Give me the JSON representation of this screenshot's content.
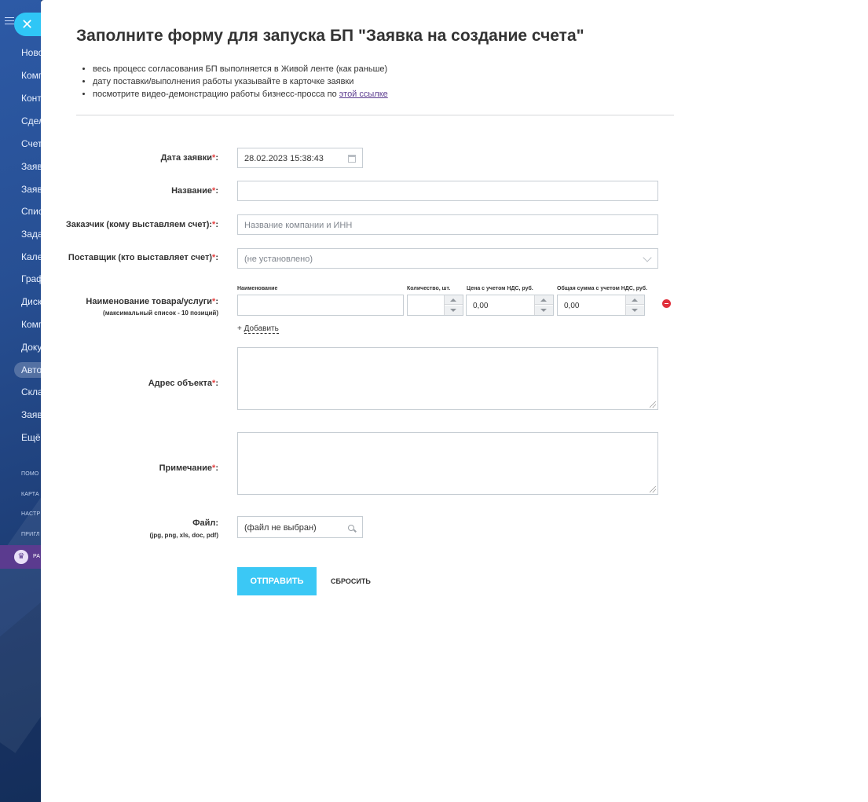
{
  "sidebar": {
    "items": [
      "Ново",
      "Комп",
      "Конт",
      "Сдел",
      "Счет",
      "Заяв",
      "Заяв",
      "Спис",
      "Зада",
      "Кале",
      "Граф",
      "Диск",
      "Комп",
      "Доку",
      "Авто",
      "Скла",
      "Заяв",
      "Ещё"
    ],
    "small_items": [
      "ПОМО",
      "КАРТА",
      "НАСТР",
      "ПРИГЛ"
    ],
    "promo_label": "РА",
    "active_index": 14
  },
  "panel": {
    "title": "Заполните форму для запуска БП \"Заявка на создание счета\"",
    "notes": [
      "весь процесс согласования БП выполняется в Живой ленте (как раньше)",
      "дату поставки/выполнения работы указывайте в карточке заявки",
      "посмотрите видео-демонстрацию работы бизнесс-просса по "
    ],
    "notes_link": "этой ссылке"
  },
  "form": {
    "required_mark": "*",
    "date": {
      "label": "Дата заявки",
      "suffix": ":",
      "value": "28.02.2023 15:38:43"
    },
    "name": {
      "label": "Название",
      "suffix": ":",
      "value": ""
    },
    "customer": {
      "label": "Заказчик (кому выставляем счет):",
      "suffix": ":",
      "placeholder": "Название компании и ИНН"
    },
    "supplier": {
      "label": "Поставщик (кто выставляет счет)",
      "suffix": ":",
      "value": "(не установлено)"
    },
    "goods": {
      "label": "Наименование товара/услуги",
      "suffix": ":",
      "sublabel": "(максимальный список - 10 позиций)",
      "columns": [
        "Наименование",
        "Количество, шт.",
        "Цена с учетом НДС, руб.",
        "Общая сумма с учетом НДС, руб."
      ],
      "row": {
        "name": "",
        "quantity": "",
        "price": "0,00",
        "total": "0,00"
      },
      "add_prefix": "+",
      "add_label": "Добавить"
    },
    "address": {
      "label": "Адрес объекта",
      "suffix": ":"
    },
    "note": {
      "label": "Примечание",
      "suffix": ":"
    },
    "file": {
      "label": "Файл:",
      "sublabel": "(jpg, png, xls, doc, pdf)",
      "value": "(файл не выбран)"
    },
    "submit_label": "ОТПРАВИТЬ",
    "reset_label": "СБРОСИТЬ"
  },
  "colors": {
    "accent": "#3bc8f5",
    "required": "#e54141",
    "close": "#2fc6f6",
    "delete": "#e0303c"
  }
}
